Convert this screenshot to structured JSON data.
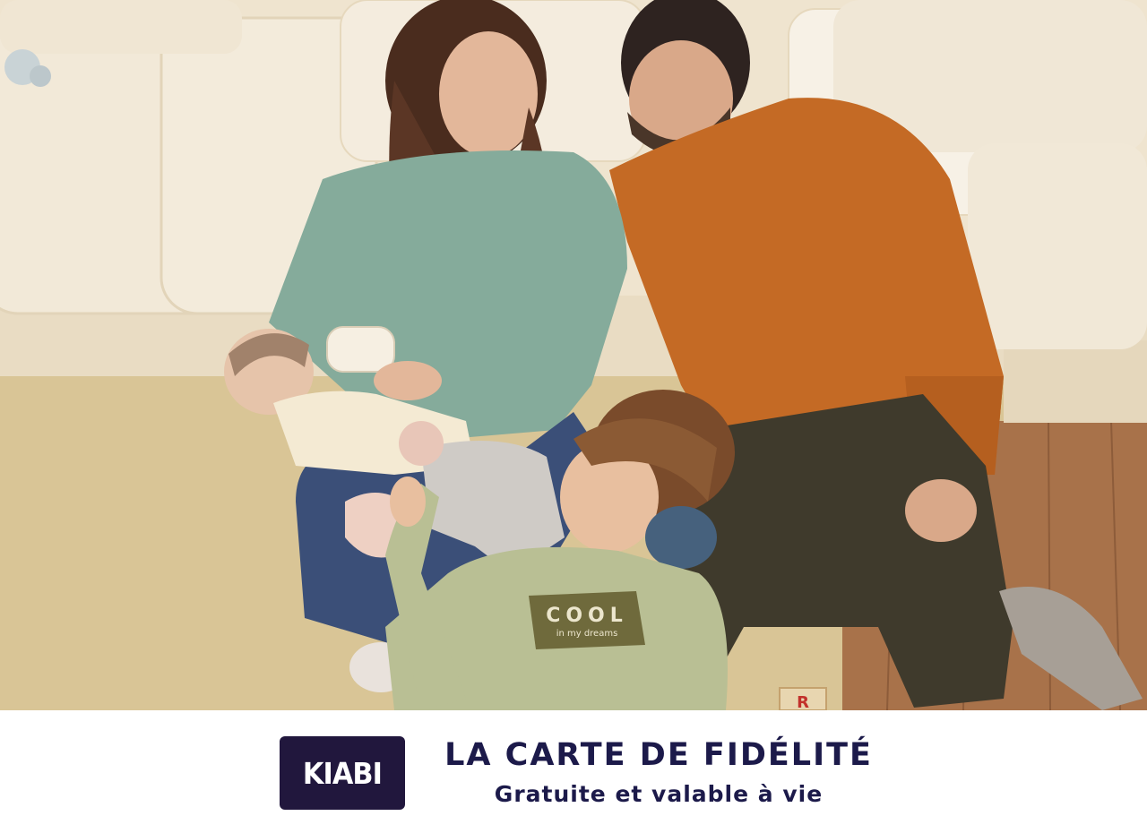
{
  "brand": {
    "logo_text": "KIABI",
    "logo_bg": "#21173d",
    "text_color": "#ffffff"
  },
  "promo": {
    "headline": "LA CARTE DE FIDÉLITÉ",
    "subline": "Gratuite et valable à vie",
    "text_color": "#1c1a4a"
  },
  "photo": {
    "sweater_print_main": "COOL",
    "sweater_print_sub": "in my dreams",
    "toy_block_letter": "R"
  }
}
